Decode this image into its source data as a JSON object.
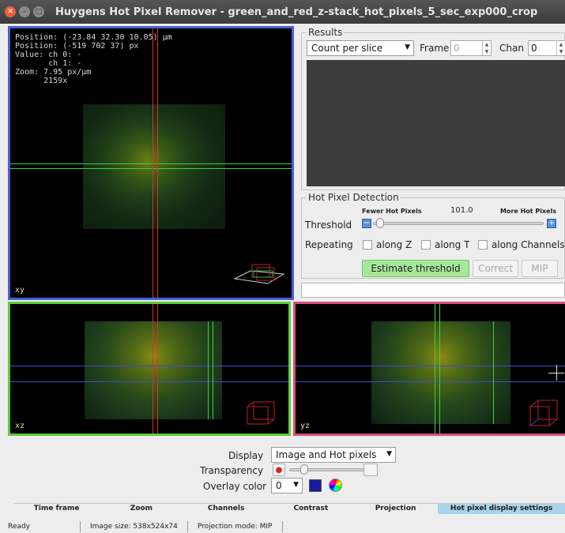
{
  "window": {
    "title": "Huygens Hot Pixel Remover - green_and_red_z-stack_hot_pixels_5_sec_exp000_crop"
  },
  "viewer": {
    "xy_info": "Position: (-23.84 32.30 10.05) µm\nPosition: (-519 702 37) px\nValue: ch 0: -\n       ch 1: -\nZoom: 7.95 px/µm\n      2159x",
    "xy_label": "xy",
    "xz_label": "xz",
    "yz_label": "yz"
  },
  "results": {
    "group_title": "Results",
    "view_select": "Count per slice",
    "frame_label": "Frame",
    "frame_value": "0",
    "chan_label": "Chan",
    "chan_value": "0"
  },
  "detection": {
    "group_title": "Hot Pixel Detection",
    "fewer_label": "Fewer Hot Pixels",
    "threshold_value": "101.0",
    "more_label": "More Hot Pixels",
    "threshold_label": "Threshold",
    "threshold_fraction": 0.02,
    "repeating_label": "Repeating",
    "along_z": "along Z",
    "along_t": "along T",
    "along_channels": "along Channels",
    "estimate_button": "Estimate threshold",
    "correct_button": "Correct",
    "mip_button": "MIP"
  },
  "display_settings": {
    "display_label": "Display",
    "display_value": "Image and Hot pixels",
    "transparency_label": "Transparency",
    "overlay_label": "Overlay color",
    "overlay_value": "0",
    "overlay_color": "#1a1aa0"
  },
  "tabs": [
    {
      "label": "Time frame"
    },
    {
      "label": "Zoom"
    },
    {
      "label": "Channels"
    },
    {
      "label": "Contrast"
    },
    {
      "label": "Projection"
    },
    {
      "label": "Hot pixel display settings"
    }
  ],
  "status": {
    "state": "Ready",
    "image_size": "Image size: 538x524x74",
    "projection_mode": "Projection mode: MIP"
  },
  "colors": {
    "xy_border": "#4a5fd8",
    "xz_border": "#5ecb3a",
    "yz_border": "#d44f7c",
    "primary_button": "#a6e89a",
    "active_tab": "#a9d3ea"
  }
}
